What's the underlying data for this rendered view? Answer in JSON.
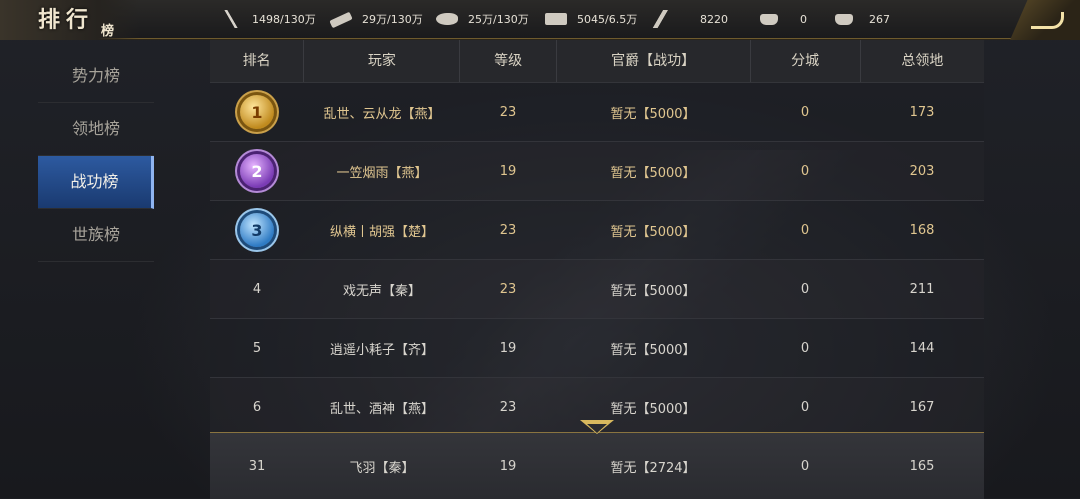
{
  "header": {
    "title": "排行",
    "title_sub": "榜",
    "resources": [
      {
        "icon": "wheat-icon",
        "value": "1498/130万"
      },
      {
        "icon": "wood-icon",
        "value": "29万/130万"
      },
      {
        "icon": "stone-icon",
        "value": "25万/130万"
      },
      {
        "icon": "iron-icon",
        "value": "5045/6.5万"
      },
      {
        "icon": "command-icon",
        "value": "8220"
      },
      {
        "icon": "gold-ingot-icon",
        "value": "0"
      },
      {
        "icon": "silver-ingot-icon",
        "value": "267"
      }
    ]
  },
  "sidebar": {
    "items": [
      {
        "label": "势力榜",
        "active": false
      },
      {
        "label": "领地榜",
        "active": false
      },
      {
        "label": "战功榜",
        "active": true
      },
      {
        "label": "世族榜",
        "active": false
      }
    ]
  },
  "table": {
    "columns": [
      "排名",
      "玩家",
      "等级",
      "官爵【战功】",
      "分城",
      "总领地"
    ],
    "rows": [
      {
        "rank": "1",
        "player": "乱世、云从龙【燕】",
        "level": "23",
        "title": "暂无【5000】",
        "city": "0",
        "land": "173"
      },
      {
        "rank": "2",
        "player": "一笠烟雨【燕】",
        "level": "19",
        "title": "暂无【5000】",
        "city": "0",
        "land": "203"
      },
      {
        "rank": "3",
        "player": "纵横丨胡强【楚】",
        "level": "23",
        "title": "暂无【5000】",
        "city": "0",
        "land": "168"
      },
      {
        "rank": "4",
        "player": "戏无声【秦】",
        "level": "23",
        "title": "暂无【5000】",
        "city": "0",
        "land": "211"
      },
      {
        "rank": "5",
        "player": "逍遥小耗子【齐】",
        "level": "19",
        "title": "暂无【5000】",
        "city": "0",
        "land": "144"
      },
      {
        "rank": "6",
        "player": "乱世、酒神【燕】",
        "level": "23",
        "title": "暂无【5000】",
        "city": "0",
        "land": "167"
      }
    ]
  },
  "my_rank": {
    "rank": "31",
    "player": "飞羽【秦】",
    "level": "19",
    "title": "暂无【2724】",
    "city": "0",
    "land": "165"
  }
}
